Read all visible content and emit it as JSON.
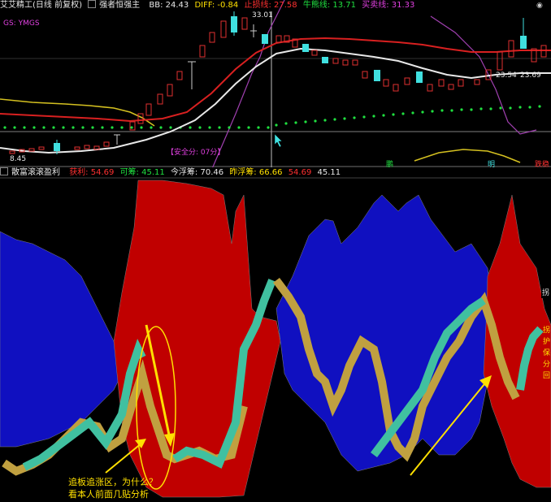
{
  "top_panel": {
    "title": "艾艾精工(日线 前复权)",
    "indicator": "强者恒强主",
    "bb_label": "BB: 24.43",
    "diff_label": "DIFF: -0.84",
    "stop_label": "止损线: 27.58",
    "bull_label": "牛熊线: 13.71",
    "sell_label": "买卖线: 31.33",
    "legend_left": "GS: YMGS",
    "price_high": "33.01",
    "price_low": "8.45",
    "price_mid_left": "23.54",
    "price_mid_right": "23.69",
    "score_label": "【安全分: 07分】",
    "marker_up": "鹏",
    "marker_mid": "明",
    "marker_right": "跌稳",
    "colors": {
      "red_line": "#e02020",
      "white_line": "#e8e8e8",
      "yellow_line": "#d4c020",
      "magenta_line": "#b040c0",
      "green_dots": "#20e040",
      "up_candle": "#e03030",
      "down_candle": "#40e0e0"
    }
  },
  "bottom_panel": {
    "indicator": "散富滚滚盈利",
    "profit_label": "获利: 54.69",
    "chip_label": "可筹: 45.11",
    "today_label": "今浮筹: 70.46",
    "yday_label": "昨浮筹: 66.66",
    "val_a": "54.69",
    "val_b": "45.11",
    "right_marker": "拐",
    "right_texts": [
      "拐",
      "护",
      "保",
      "分",
      "回"
    ],
    "colors": {
      "red_fill": "#c00000",
      "blue_fill": "#1010c0",
      "teal_band": "#40c0a0",
      "gold_band": "#c0a040",
      "green_line": "#40c040"
    }
  },
  "annotation": {
    "line1": "追板追涨区，为什么？",
    "line2": "看本人前面几贴分析"
  }
}
